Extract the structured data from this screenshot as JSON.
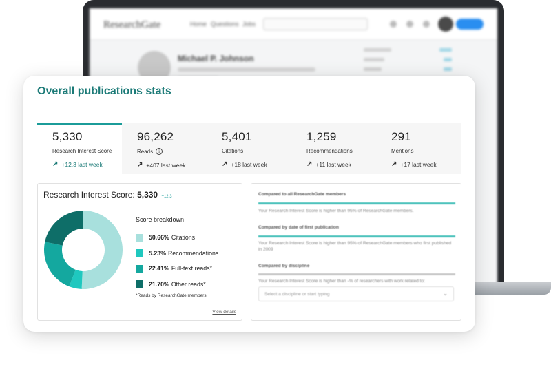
{
  "background_screen": {
    "logo": "ResearchGate",
    "nav": [
      "Home",
      "Questions",
      "Jobs"
    ],
    "profile_name": "Michael P. Johnson"
  },
  "card": {
    "title": "Overall publications stats"
  },
  "tabs": [
    {
      "value": "5,330",
      "label": "Research Interest Score",
      "trend": "+12.3 last week",
      "active": true
    },
    {
      "value": "96,262",
      "label": "Reads",
      "trend": "+407 last week",
      "info": "i"
    },
    {
      "value": "5,401",
      "label": "Citations",
      "trend": "+18 last week"
    },
    {
      "value": "1,259",
      "label": "Recommendations",
      "trend": "+11 last week"
    },
    {
      "value": "291",
      "label": "Mentions",
      "trend": "+17 last week"
    }
  ],
  "score_panel": {
    "title_prefix": "Research Interest Score:",
    "title_value": "5,330",
    "delta": "+12.3",
    "breakdown_title": "Score breakdown",
    "legend": [
      {
        "percent": "50.66%",
        "label": "Citations",
        "color": "#a8e0dd",
        "value": 50.66
      },
      {
        "percent": "5.23%",
        "label": "Recommendations",
        "color": "#1fc8bf",
        "value": 5.23
      },
      {
        "percent": "22.41%",
        "label": "Full-text reads*",
        "color": "#14a89f",
        "value": 22.41
      },
      {
        "percent": "21.70%",
        "label": "Other reads*",
        "color": "#0e6e68",
        "value": 21.7
      }
    ],
    "footnote": "*Reads by ResearchGate members",
    "view_details": "View details"
  },
  "compare_panel": {
    "sections": [
      {
        "heading": "Compared to all ResearchGate members",
        "text": "Your Research Interest Score is higher than 95% of ResearchGate members.",
        "bar_color": "#4fc3bd"
      },
      {
        "heading": "Compared by date of first publication",
        "text": "Your Research Interest Score is higher than 95% of ResearchGate members who first published in 2009",
        "bar_color": "#4fc3bd"
      },
      {
        "heading": "Compared by discipline",
        "text": "Your Research Interest Score is higher than -% of researchers with work related to:",
        "bar_color": "#c9c9c9"
      }
    ],
    "select_placeholder": "Select a discipline or start typing"
  }
}
